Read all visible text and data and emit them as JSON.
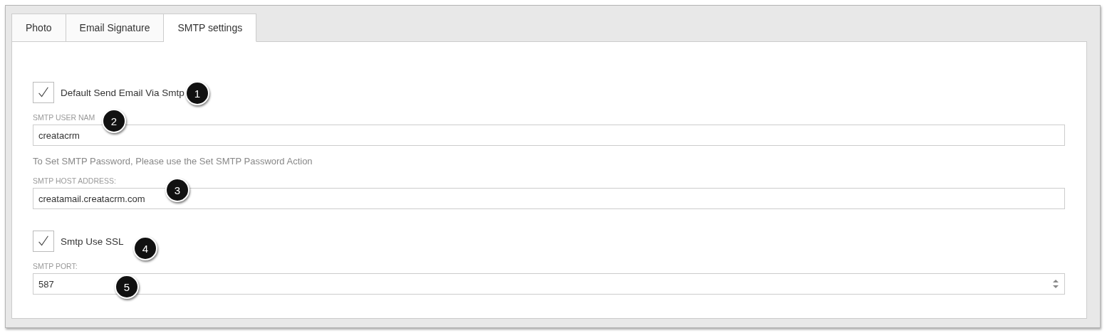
{
  "tabs": [
    {
      "label": "Photo",
      "selected": false
    },
    {
      "label": "Email Signature",
      "selected": false
    },
    {
      "label": "SMTP settings",
      "selected": true
    }
  ],
  "fields": [
    {
      "kind": "checkbox",
      "label": "Default Send Email Via Smtp",
      "checked": true,
      "callout": "1"
    },
    {
      "kind": "text",
      "label": "SMTP USER NAM",
      "value": "creatacrm",
      "callout": "2"
    },
    {
      "kind": "note",
      "label": "To Set SMTP Password, Please use the Set SMTP Password Action"
    },
    {
      "kind": "text",
      "label": "SMTP HOST ADDRESS:",
      "value": "creatamail.creatacrm.com",
      "callout": "3"
    },
    {
      "kind": "checkbox",
      "label": "Smtp Use SSL",
      "checked": true,
      "callout": "4"
    },
    {
      "kind": "number",
      "label": "SMTP PORT:",
      "value": "587",
      "callout": "5"
    }
  ]
}
